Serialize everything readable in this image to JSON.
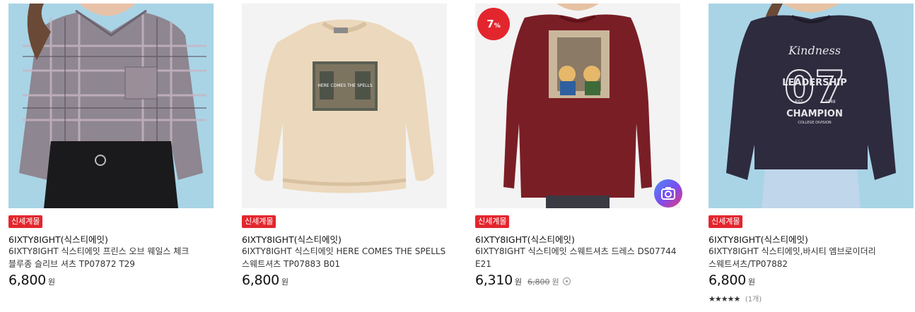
{
  "products": [
    {
      "badge": "신세계몰",
      "brand": "6IXTY8IGHT(식스티에잇)",
      "title": "6IXTY8IGHT 식스티에잇 프린스 오브 웨일스 체크 블루종 슬리브 셔츠 TP07872 T29",
      "price": "6,800",
      "currency": "원",
      "image": "plaid-shirt"
    },
    {
      "badge": "신세계몰",
      "brand": "6IXTY8IGHT(식스티에잇)",
      "title": "6IXTY8IGHT 식스티에잇 HERE COMES THE SPELLS 스웨트셔츠 TP07883 B01",
      "price": "6,800",
      "currency": "원",
      "image": "beige-sweatshirt"
    },
    {
      "badge": "신세계몰",
      "brand": "6IXTY8IGHT(식스티에잇)",
      "title": "6IXTY8IGHT 식스티에잇 스웨트셔츠 드레스 DS07744 E21",
      "price": "6,310",
      "currency": "원",
      "original_price": "6,800",
      "discount": "7",
      "discount_unit": "%",
      "image": "burgundy-dress"
    },
    {
      "badge": "신세계몰",
      "brand": "6IXTY8IGHT(식스티에잇)",
      "title": "6IXTY8IGHT 식스티에잇,바시티 엠브로이더리 스웨트셔츠/TP07882",
      "price": "6,800",
      "currency": "원",
      "rating_stars": "★★★★★",
      "rating_value": 5,
      "review_count": "(1개)",
      "image": "navy-sweatshirt"
    }
  ],
  "sweatshirt_print": "HERE COMES THE SPELLS",
  "navy_print": {
    "top": "Kindness",
    "number": "07",
    "middle": "LEADERSHIP",
    "est": "EST",
    "year": "1948",
    "bottom": "CHAMPION",
    "sub": "COLLEGE DIVISION"
  },
  "colors": {
    "badge": "#e3262e",
    "discount": "#e3262e",
    "image_bg_blue": "#a9d4e6",
    "image_bg_grey": "#f3f3f3"
  }
}
